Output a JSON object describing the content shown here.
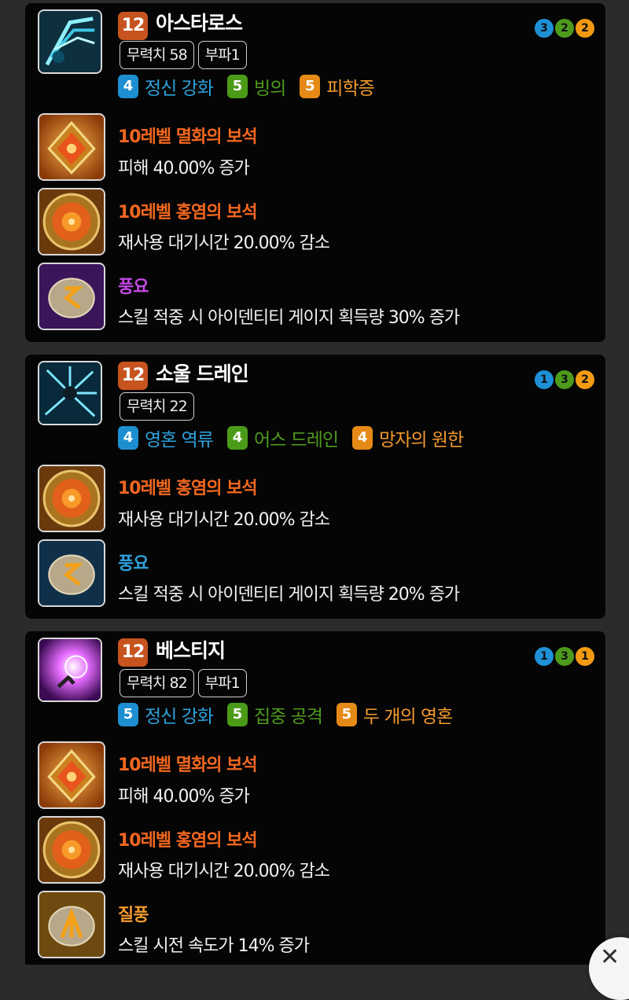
{
  "cards": [
    {
      "level": "12",
      "name": "아스타로스",
      "tags": [
        "무력치 58",
        "부파1"
      ],
      "dots": [
        "3",
        "2",
        "2"
      ],
      "tripods": [
        {
          "num": "4",
          "label": "정신 강화",
          "color": "blue"
        },
        {
          "num": "5",
          "label": "빙의",
          "color": "green"
        },
        {
          "num": "5",
          "label": "피학증",
          "color": "orange"
        }
      ],
      "items": [
        {
          "title": "10레벨 멸화의 보석",
          "desc": "피해 40.00% 증가",
          "icon": "gem-annihilation-icon"
        },
        {
          "title": "10레벨 홍염의 보석",
          "desc": "재사용 대기시간 20.00% 감소",
          "icon": "gem-crimson-flame-icon"
        },
        {
          "title": "풍요",
          "desc": "스킬 적중 시 아이덴티티 게이지 획득량 30% 증가",
          "icon": "rune-abundance-icon"
        }
      ]
    },
    {
      "level": "12",
      "name": "소울 드레인",
      "tags": [
        "무력치 22"
      ],
      "dots": [
        "1",
        "3",
        "2"
      ],
      "tripods": [
        {
          "num": "4",
          "label": "영혼 역류",
          "color": "blue"
        },
        {
          "num": "4",
          "label": "어스 드레인",
          "color": "green"
        },
        {
          "num": "4",
          "label": "망자의 원한",
          "color": "orange"
        }
      ],
      "items": [
        {
          "title": "10레벨 홍염의 보석",
          "desc": "재사용 대기시간 20.00% 감소",
          "icon": "gem-crimson-flame-icon"
        },
        {
          "title": "풍요",
          "desc": "스킬 적중 시 아이덴티티 게이지 획득량 20% 증가",
          "icon": "rune-abundance-icon"
        }
      ]
    },
    {
      "level": "12",
      "name": "베스티지",
      "tags": [
        "무력치 82",
        "부파1"
      ],
      "dots": [
        "1",
        "3",
        "1"
      ],
      "tripods": [
        {
          "num": "5",
          "label": "정신 강화",
          "color": "blue"
        },
        {
          "num": "5",
          "label": "집중 공격",
          "color": "green"
        },
        {
          "num": "5",
          "label": "두 개의 영혼",
          "color": "orange"
        }
      ],
      "items": [
        {
          "title": "10레벨 멸화의 보석",
          "desc": "피해 40.00% 증가",
          "icon": "gem-annihilation-icon"
        },
        {
          "title": "10레벨 홍염의 보석",
          "desc": "재사용 대기시간 20.00% 감소",
          "icon": "gem-crimson-flame-icon"
        },
        {
          "title": "질풍",
          "desc": "스킬 시전 속도가 14% 증가",
          "icon": "rune-gale-icon"
        }
      ]
    }
  ],
  "close_button": {
    "glyph": "✕",
    "icon": "close-icon"
  },
  "colors": {
    "background": "#050505",
    "level_badge": "#c7531e",
    "tripod_blue": "#1d8fd1",
    "tripod_green": "#4b9b18",
    "tripod_orange": "#e58a17",
    "gem_title": "#f2671f",
    "rune_purple_title": "#c548e6",
    "rune_blue_title": "#2ea2de",
    "rune_gold_title": "#f29a2e"
  }
}
